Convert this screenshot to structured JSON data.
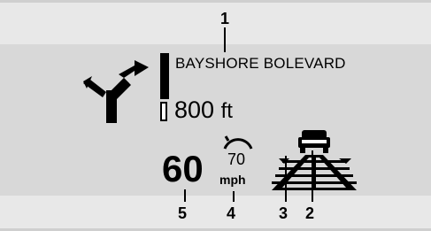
{
  "navigation": {
    "street_name": "BAYSHORE BOLEVARD",
    "distance_value": "800",
    "distance_unit": "ft",
    "turn_icon": "turn-right-arrow-icon"
  },
  "speed": {
    "current_speed": "60",
    "set_limit": "70",
    "unit": "mph",
    "limit_icon": "speed-limit-gauge-icon"
  },
  "assist": {
    "lane_icon": "lane-departure-warning-icon",
    "vehicle_icon": "vehicle-ahead-icon"
  },
  "callouts": {
    "c1": "1",
    "c2": "2",
    "c3": "3",
    "c4": "4",
    "c5": "5"
  },
  "colors": {
    "display_bg": "#d8d8d8",
    "band_bg": "#e8e8e8",
    "foreground": "#000000"
  }
}
